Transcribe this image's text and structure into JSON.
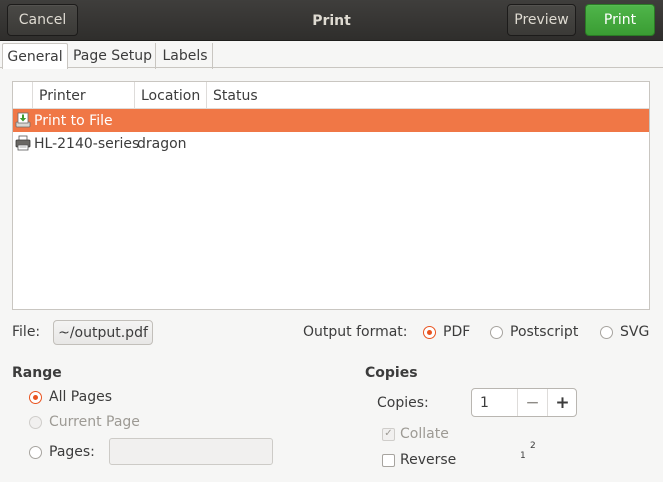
{
  "window": {
    "title": "Print",
    "cancel_label": "Cancel",
    "preview_label": "Preview",
    "print_label": "Print"
  },
  "tabs": [
    {
      "label": "General",
      "active": true
    },
    {
      "label": "Page Setup",
      "active": false
    },
    {
      "label": "Labels",
      "active": false
    }
  ],
  "printer_list": {
    "columns": [
      "Printer",
      "Location",
      "Status"
    ],
    "rows": [
      {
        "name": "Print to File",
        "location": "",
        "status": "",
        "icon": "print-to-file-icon",
        "selected": true
      },
      {
        "name": "HL-2140-series",
        "location": "dragon",
        "status": "",
        "icon": "printer-icon",
        "selected": false
      }
    ]
  },
  "file": {
    "label": "File:",
    "value": "~/output.pdf"
  },
  "output_format": {
    "label": "Output format:",
    "options": [
      "PDF",
      "Postscript",
      "SVG"
    ],
    "selected": "PDF"
  },
  "range": {
    "title": "Range",
    "all_pages": "All Pages",
    "current_page": "Current Page",
    "pages": "Pages:",
    "pages_value": "",
    "selected": "All Pages"
  },
  "copies": {
    "title": "Copies",
    "label": "Copies:",
    "value": "1",
    "minus": "−",
    "plus": "+",
    "collate_label": "Collate",
    "collate_checked": true,
    "reverse_label": "Reverse",
    "reverse_checked": false,
    "collate_sheet_front": "2",
    "collate_sheet_back": "1"
  },
  "colors": {
    "accent": "#e95420",
    "selection": "#f07746",
    "print_button": "#3a9d33",
    "header_bg": "#363533"
  }
}
